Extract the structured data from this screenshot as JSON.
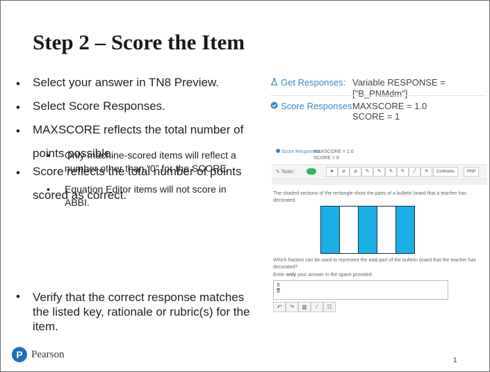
{
  "title": "Step 2 – Score the Item",
  "bullets": [
    "Select your answer in TN8 Preview.",
    "Select Score Responses.",
    "MAXSCORE reflects the total number of",
    "points possible.",
    "Score reflects the total number of points",
    "scored as correct."
  ],
  "sub_bullets": [
    "Only machine-scored items will reflect a number other than “0” for the SCORE.",
    "Equation Editor items will not score in ABBI."
  ],
  "final_bullet": "Verify that the correct response matches the listed key, rationale or rubric(s) for the item.",
  "bullet_glyph": "•",
  "get_responses": {
    "label": "Get Responses:",
    "value": "Variable RESPONSE = [\"B_PNMdm\"]",
    "icon": "flask-icon"
  },
  "score_responses": {
    "label": "Score Responses:",
    "maxscore": "MAXSCORE = 1.0",
    "score": "SCORE = 1",
    "icon": "check-circle-icon"
  },
  "screenshot": {
    "score_label": "Score Responses:",
    "maxscore": "MAXSCORE = 1.0",
    "score": "SCORE = 0",
    "tools_label": "Tools:",
    "contrasts": "Contrasts",
    "pnp": "PNP",
    "question1": "The shaded sections of the rectangle show the parts of a bulletin board that a teacher has decorated.",
    "question2": "Which fraction can be used to represent the total part of the bulletin board that the teacher has decorated?",
    "q3_pre": "Enter ",
    "q3_bold": "only",
    "q3_post": " your answer in the space provided.",
    "frac_num": "5",
    "frac_den": "8",
    "shaded_parts": 3,
    "total_parts": 5
  },
  "colors": {
    "accent": "#3a87c8",
    "shade": "#1ab0e6",
    "toggle": "#35b35b",
    "pearson": "#1f6fb5"
  },
  "footer": {
    "logo_letter": "P",
    "brand": "Pearson",
    "page_number": "1"
  }
}
